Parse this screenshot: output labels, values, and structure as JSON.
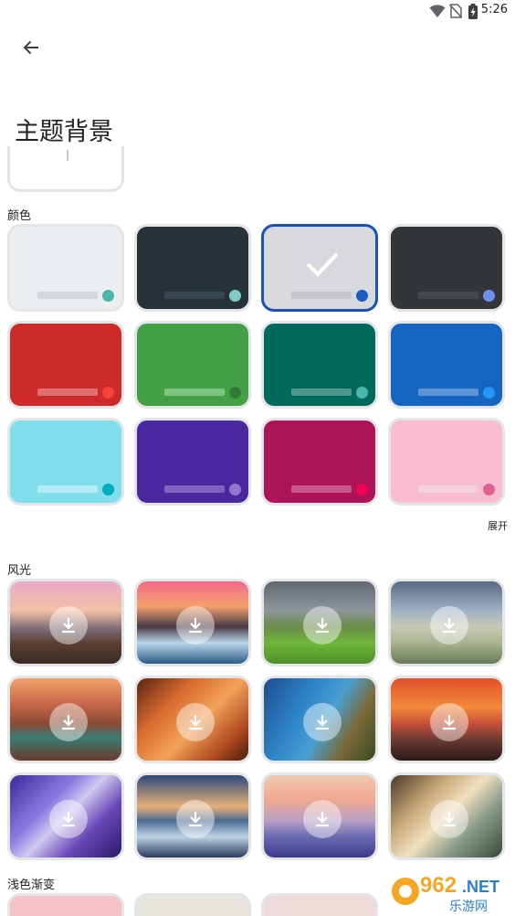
{
  "status": {
    "time": "5:26"
  },
  "page": {
    "title": "主题背景"
  },
  "colors_section": {
    "label": "颜色",
    "expand_label": "展开",
    "tiles": [
      {
        "bg": "#eceff1",
        "bar": "#d4d6d8",
        "dot": "#4db6ac",
        "selected": false
      },
      {
        "bg": "#263238",
        "bar": "#37474f",
        "dot": "#80cbc4",
        "selected": false
      },
      {
        "bg": "#d7d9dc",
        "bar": "#c4c6c9",
        "dot": "#1e5ec2",
        "selected": true
      },
      {
        "bg": "#333638",
        "bar": "#45484b",
        "dot": "#6e8ff0",
        "selected": false
      },
      {
        "bg": "#cd2b2b",
        "bar": "#e07070",
        "dot": "#f44336",
        "selected": false
      },
      {
        "bg": "#43a047",
        "bar": "#7cc47f",
        "dot": "#2e7d32",
        "selected": false
      },
      {
        "bg": "#00695c",
        "bar": "#4d968c",
        "dot": "#4db6ac",
        "selected": false
      },
      {
        "bg": "#1565c0",
        "bar": "#5b93d3",
        "dot": "#2196f3",
        "selected": false
      },
      {
        "bg": "#80deea",
        "bar": "#b3ecf3",
        "dot": "#00acc1",
        "selected": false
      },
      {
        "bg": "#4a28a0",
        "bar": "#7e63bf",
        "dot": "#9575cd",
        "selected": false
      },
      {
        "bg": "#ad1457",
        "bar": "#c85688",
        "dot": "#f50057",
        "selected": false
      },
      {
        "bg": "#f8bbd0",
        "bar": "#f2d0dc",
        "dot": "#e06090",
        "selected": false
      }
    ]
  },
  "landscape_section": {
    "label": "风光",
    "tiles": [
      {
        "name": "sunset-beach",
        "sky": "linear-gradient(180deg,#e9a9c6 0%,#f3c1a6 35%,#7b6b74 58%,#5a4033 75%,#3a2a22 100%)"
      },
      {
        "name": "frozen-lake",
        "sky": "linear-gradient(180deg,#f06a88 0%,#f4a06e 30%,#4a3a46 55%,#b9d7ea 75%,#2d5b86 100%)"
      },
      {
        "name": "green-hills",
        "sky": "linear-gradient(180deg,#5f6670 0%,#8e959c 35%,#6a8d4a 55%,#6fb53a 75%,#4f8f2a 100%)"
      },
      {
        "name": "cloudy-coast",
        "sky": "linear-gradient(180deg,#5a6a80 0%,#9fb0c4 35%,#c7c9b6 55%,#a8b390 75%,#6a7a55 100%)"
      },
      {
        "name": "canyon-bend",
        "sky": "linear-gradient(180deg,#f2a16b 0%,#c96a4a 30%,#8a4a36 55%,#3a7c74 72%,#6a3a2a 100%)"
      },
      {
        "name": "slot-canyon",
        "sky": "linear-gradient(135deg,#5a2414 0%,#d86a2e 30%,#f2a25a 55%,#b04a20 80%,#4a1a0a 100%)"
      },
      {
        "name": "ocean-cliffs",
        "sky": "linear-gradient(120deg,#1e4c90 0%,#2e86c8 35%,#4a9fd0 55%,#7a6a3a 75%,#3a4a20 100%)"
      },
      {
        "name": "red-sunset",
        "sky": "linear-gradient(180deg,#e0502a 0%,#f08a3a 35%,#c8503a 55%,#6a3a32 75%,#2a1a1a 100%)"
      },
      {
        "name": "purple-stream",
        "sky": "linear-gradient(135deg,#3a2a9a 0%,#8a7ae0 35%,#d0c8f0 50%,#6a4ab8 70%,#2a1a6a 100%)"
      },
      {
        "name": "blue-shore",
        "sky": "linear-gradient(180deg,#2a4a7a 0%,#e8b07a 38%,#4a6a90 55%,#bcd4e4 75%,#2a3a5a 100%)"
      },
      {
        "name": "mountain-haze",
        "sky": "linear-gradient(180deg,#f0c8b0 0%,#f0a890 30%,#b8a0c8 55%,#6a6ab0 75%,#3a3a8a 100%)"
      },
      {
        "name": "waves",
        "sky": "linear-gradient(135deg,#4a3a2a 0%,#c8a878 30%,#f0e0c0 50%,#8a9a8a 70%,#3a4a3a 100%)"
      }
    ]
  },
  "light_gradient_section": {
    "label": "浅色渐变",
    "tiles": [
      {
        "bg": "#f6c3c8"
      },
      {
        "bg": "#e9e6df"
      },
      {
        "bg": "#eedad9"
      }
    ]
  },
  "watermark": {
    "text_top": "962",
    "text_suffix": ".NET",
    "text_bottom": "乐游网"
  }
}
